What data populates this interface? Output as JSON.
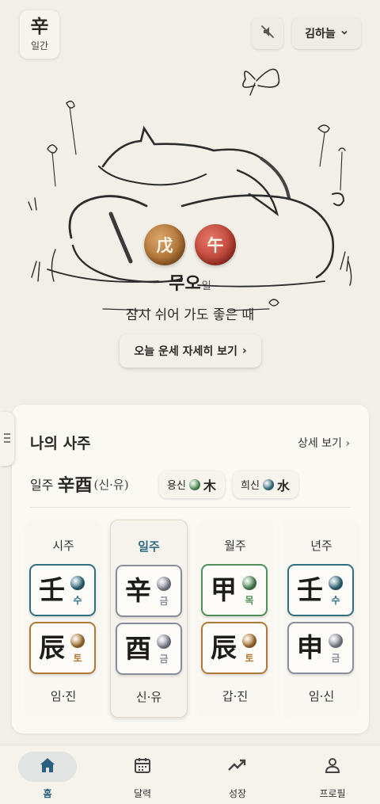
{
  "topbar": {
    "day_master_char": "辛",
    "day_master_label": "일간",
    "user_name": "김하늘",
    "mute_icon": "speaker-off-icon",
    "user_chevron_icon": "chevron-down-icon"
  },
  "hero": {
    "stem_char": "戊",
    "branch_char": "午",
    "day_name": "무오",
    "day_suffix": "일",
    "message": "잠시 쉬어 가도 좋은 때",
    "detail_button": "오늘 운세 자세히 보기",
    "detail_chevron": "›"
  },
  "saju": {
    "title": "나의 사주",
    "more_link": "상세 보기 ›",
    "ilju_label": "일주",
    "ilju_hanja": "辛酉",
    "ilju_reading": "(신·유)",
    "yongsin": {
      "label": "용신",
      "element": "木",
      "color": "#5a9a63"
    },
    "huisin": {
      "label": "희신",
      "element": "水",
      "color": "#3d7a8c"
    },
    "pillars": [
      {
        "label": "시주",
        "active": false,
        "stem": {
          "char": "壬",
          "element": "수",
          "color": "#2f6f80"
        },
        "branch": {
          "char": "辰",
          "element": "토",
          "color": "#b07a36"
        },
        "reading": "임·진"
      },
      {
        "label": "일주",
        "active": true,
        "stem": {
          "char": "辛",
          "element": "금",
          "color": "#8a8d9c"
        },
        "branch": {
          "char": "酉",
          "element": "금",
          "color": "#8a8d9c"
        },
        "reading": "신·유"
      },
      {
        "label": "월주",
        "active": false,
        "stem": {
          "char": "甲",
          "element": "목",
          "color": "#4f8f58"
        },
        "branch": {
          "char": "辰",
          "element": "토",
          "color": "#b07a36"
        },
        "reading": "갑·진"
      },
      {
        "label": "년주",
        "active": false,
        "stem": {
          "char": "壬",
          "element": "수",
          "color": "#2f6f80"
        },
        "branch": {
          "char": "申",
          "element": "금",
          "color": "#8a8d9c"
        },
        "reading": "임·신"
      }
    ]
  },
  "nav": {
    "items": [
      {
        "label": "홈",
        "icon": "home-icon",
        "active": true
      },
      {
        "label": "달력",
        "icon": "calendar-icon",
        "active": false
      },
      {
        "label": "성장",
        "icon": "trending-up-icon",
        "active": false
      },
      {
        "label": "프로필",
        "icon": "profile-icon",
        "active": false
      }
    ]
  }
}
